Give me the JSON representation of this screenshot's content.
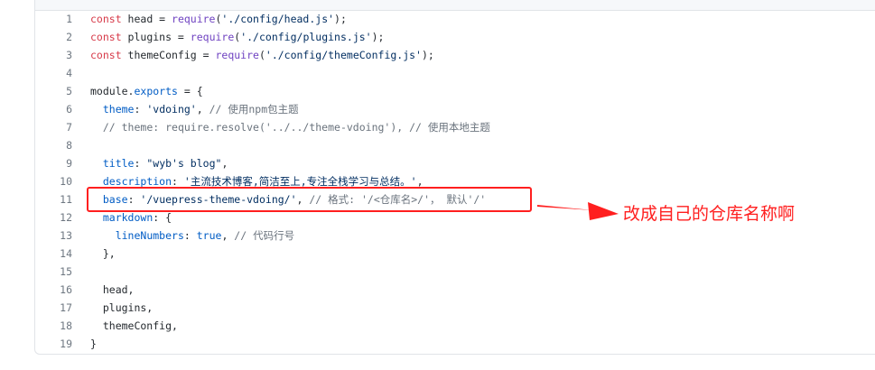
{
  "editor": {
    "line_numbers": [
      "1",
      "2",
      "3",
      "4",
      "5",
      "6",
      "7",
      "8",
      "9",
      "10",
      "11",
      "12",
      "13",
      "14",
      "15",
      "16",
      "17",
      "18",
      "19"
    ],
    "lines": [
      [
        {
          "t": "const",
          "c": "kw"
        },
        {
          "t": " head = ",
          "c": "pl"
        },
        {
          "t": "require",
          "c": "fn"
        },
        {
          "t": "(",
          "c": "pl"
        },
        {
          "t": "'./config/head.js'",
          "c": "str"
        },
        {
          "t": ");",
          "c": "pl"
        }
      ],
      [
        {
          "t": "const",
          "c": "kw"
        },
        {
          "t": " plugins = ",
          "c": "pl"
        },
        {
          "t": "require",
          "c": "fn"
        },
        {
          "t": "(",
          "c": "pl"
        },
        {
          "t": "'./config/plugins.js'",
          "c": "str"
        },
        {
          "t": ");",
          "c": "pl"
        }
      ],
      [
        {
          "t": "const",
          "c": "kw"
        },
        {
          "t": " themeConfig = ",
          "c": "pl"
        },
        {
          "t": "require",
          "c": "fn"
        },
        {
          "t": "(",
          "c": "pl"
        },
        {
          "t": "'./config/themeConfig.js'",
          "c": "str"
        },
        {
          "t": ");",
          "c": "pl"
        }
      ],
      [],
      [
        {
          "t": "module",
          "c": "pl"
        },
        {
          "t": ".",
          "c": "pl"
        },
        {
          "t": "exports",
          "c": "prop"
        },
        {
          "t": " = {",
          "c": "pl"
        }
      ],
      [
        {
          "t": "  ",
          "c": "pl"
        },
        {
          "t": "theme",
          "c": "prop"
        },
        {
          "t": ": ",
          "c": "pl"
        },
        {
          "t": "'vdoing'",
          "c": "str"
        },
        {
          "t": ", ",
          "c": "pl"
        },
        {
          "t": "// 使用npm包主题",
          "c": "cm"
        }
      ],
      [
        {
          "t": "  ",
          "c": "pl"
        },
        {
          "t": "// theme: require.resolve('../../theme-vdoing'), // 使用本地主题",
          "c": "cm"
        }
      ],
      [],
      [
        {
          "t": "  ",
          "c": "pl"
        },
        {
          "t": "title",
          "c": "prop"
        },
        {
          "t": ": ",
          "c": "pl"
        },
        {
          "t": "\"wyb's blog\"",
          "c": "str"
        },
        {
          "t": ",",
          "c": "pl"
        }
      ],
      [
        {
          "t": "  ",
          "c": "pl"
        },
        {
          "t": "description",
          "c": "prop"
        },
        {
          "t": ": ",
          "c": "pl"
        },
        {
          "t": "'主流技术博客,简洁至上,专注全栈学习与总结。'",
          "c": "str"
        },
        {
          "t": ",",
          "c": "pl"
        }
      ],
      [
        {
          "t": "  ",
          "c": "pl"
        },
        {
          "t": "base",
          "c": "prop"
        },
        {
          "t": ": ",
          "c": "pl"
        },
        {
          "t": "'/vuepress-theme-vdoing/'",
          "c": "str"
        },
        {
          "t": ", ",
          "c": "pl"
        },
        {
          "t": "// 格式: '/<仓库名>/'， 默认'/'",
          "c": "cm"
        }
      ],
      [
        {
          "t": "  ",
          "c": "pl"
        },
        {
          "t": "markdown",
          "c": "prop"
        },
        {
          "t": ": {",
          "c": "pl"
        }
      ],
      [
        {
          "t": "    ",
          "c": "pl"
        },
        {
          "t": "lineNumbers",
          "c": "prop"
        },
        {
          "t": ": ",
          "c": "pl"
        },
        {
          "t": "true",
          "c": "bool"
        },
        {
          "t": ", ",
          "c": "pl"
        },
        {
          "t": "// 代码行号",
          "c": "cm"
        }
      ],
      [
        {
          "t": "  },",
          "c": "pl"
        }
      ],
      [],
      [
        {
          "t": "  head,",
          "c": "pl"
        }
      ],
      [
        {
          "t": "  plugins,",
          "c": "pl"
        }
      ],
      [
        {
          "t": "  themeConfig,",
          "c": "pl"
        }
      ],
      [
        {
          "t": "}",
          "c": "pl"
        }
      ]
    ]
  },
  "annotation": {
    "text": "改成自己的仓库名称啊",
    "color": "#ff1f1f",
    "highlighted_line": "11"
  }
}
